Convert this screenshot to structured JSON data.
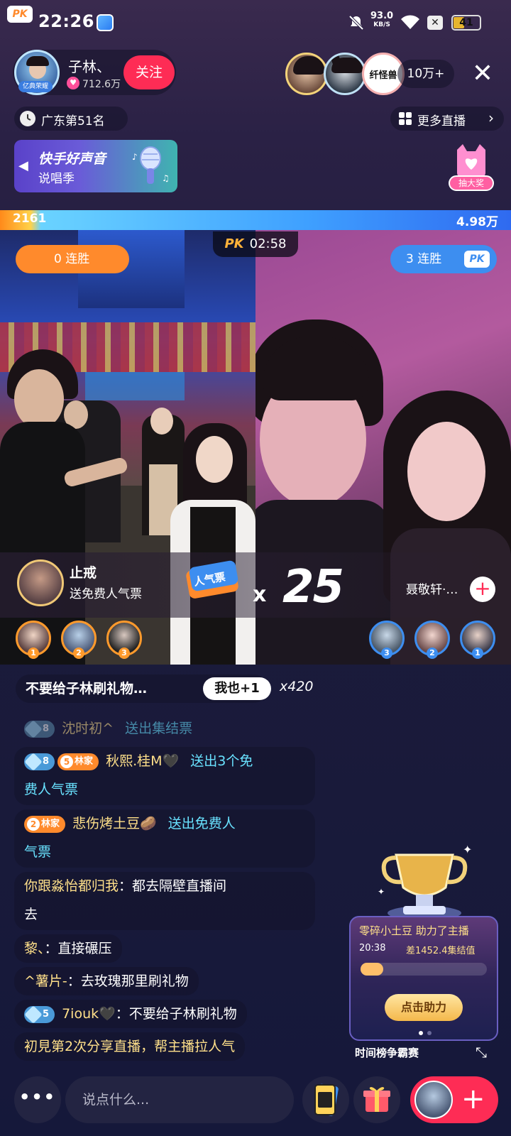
{
  "status_bar": {
    "time": "22:26",
    "speed_value": "93.0",
    "speed_unit": "KB/S",
    "battery": "41",
    "battery_level": 0.41
  },
  "host": {
    "name": "子林、",
    "likes": "712.6万",
    "follow_label": "关注",
    "badge": "亿典荣耀"
  },
  "viewers": {
    "count": "10万+",
    "top3_brand": "纤怪兽"
  },
  "rank": {
    "text": "广东第51名"
  },
  "more_live": {
    "label": "更多直播"
  },
  "banner": {
    "title": "快手好声音",
    "subtitle": "说唱季"
  },
  "lottery": {
    "label": "抽大奖"
  },
  "pk": {
    "left_score": "2161",
    "right_score": "4.98万",
    "timer_label": "PK",
    "timer": "02:58",
    "left_streak": "0 连胜",
    "right_streak": "3 连胜",
    "badge": "PK"
  },
  "gift": {
    "sender": "止戒",
    "desc": "送免费人气票",
    "ticket_text": "人气票",
    "x": "x",
    "count": "25"
  },
  "right_guest": {
    "name": "聂敬轩·…"
  },
  "supporters": {
    "left": [
      "1",
      "2",
      "3"
    ],
    "right": [
      "3",
      "2",
      "1"
    ]
  },
  "pinned": {
    "text": "不要给子林刷礼物…",
    "me_too": "我也+1",
    "count": "x420"
  },
  "chat": [
    {
      "level": "8",
      "name": "沈时初^",
      "action": "送出集结票",
      "faded": true
    },
    {
      "level": "8",
      "fan_level": "5",
      "fan_tag": "林家",
      "name": "秋熙.桂M🖤",
      "action": "送出3个免",
      "action2": "费人气票"
    },
    {
      "fan_level": "2",
      "fan_tag": "林家",
      "name": "悲伤烤土豆🥔",
      "action": "送出免费人",
      "action2": "气票"
    },
    {
      "name": "你跟淼怡都归我",
      "text": "：都去隔壁直播间",
      "text2": "去"
    },
    {
      "name": "黎、",
      "text": "：直接碾压"
    },
    {
      "name": "^薯片-",
      "text": "：去玫瑰那里刷礼物"
    },
    {
      "level": "5",
      "name": "7iouk🖤",
      "text": "：不要给子林刷礼物"
    },
    {
      "text": "初見第2次分享直播，帮主播拉人气"
    }
  ],
  "task": {
    "title": "零碎小土豆 助力了主播",
    "time": "20:38",
    "gap": "差1452.4集结值",
    "help_label": "点击助力",
    "footer": "时间榜争霸赛",
    "progress": 0.18
  },
  "bottom": {
    "more": "•••",
    "input_placeholder": "说点什么..."
  },
  "colors": {
    "accent": "#fe2c55",
    "pk_left": "#ff8a2c",
    "pk_right": "#3d8ef0"
  },
  "icons": [
    "mute-icon",
    "wifi-icon",
    "close-icon",
    "clock-icon",
    "grid-icon",
    "chevron-right-icon",
    "microphone-icon",
    "gift-icon",
    "ticket-icon",
    "plus-icon",
    "collapse-icon",
    "trophy-icon"
  ]
}
